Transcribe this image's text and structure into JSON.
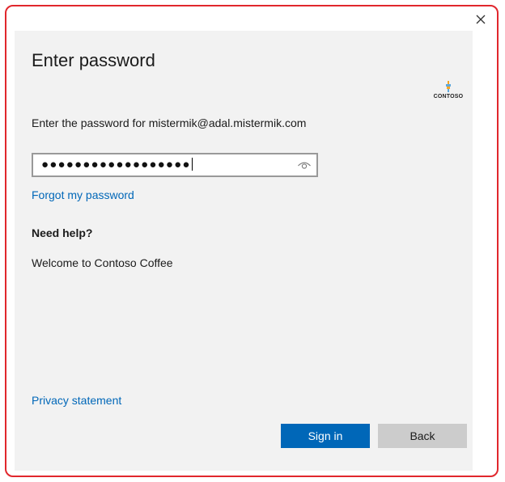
{
  "window": {
    "close_glyph": "✕"
  },
  "dialog": {
    "title": "Enter password",
    "subtitle": "Enter the password for mistermik@adal.mistermik.com",
    "password": {
      "masked_value": "●●●●●●●●●●●●●●●●●●",
      "reveal_icon": "eye-icon"
    },
    "forgot_link": "Forgot my password",
    "help_heading": "Need help?",
    "help_text": "Welcome to Contoso Coffee",
    "privacy_link": "Privacy statement",
    "buttons": {
      "sign_in": "Sign in",
      "back": "Back"
    }
  },
  "logo": {
    "text": "CONTOSO"
  },
  "colors": {
    "accent": "#0067b8",
    "window_border": "#e1272d",
    "panel_background": "#f2f2f2",
    "secondary_button": "#cccccc"
  }
}
